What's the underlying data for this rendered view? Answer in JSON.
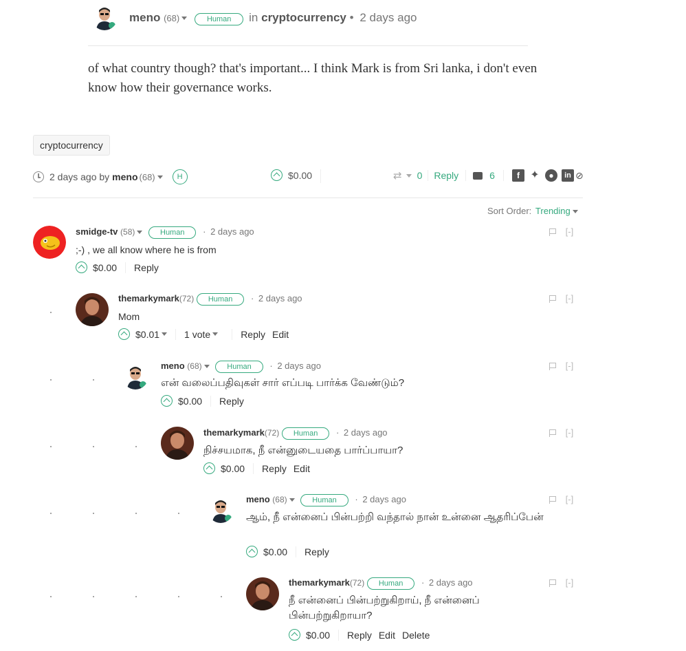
{
  "post": {
    "author": "meno",
    "reputation": "(68)",
    "badge": "Human",
    "in_word": "in",
    "community": "cryptocurrency",
    "bullet": "•",
    "time": "2 days ago",
    "body": "of what country though? that's important... I think Mark is from Sri lanka, i don't even know how their governance works.",
    "tag": "cryptocurrency",
    "footer": {
      "time": "2 days ago by",
      "author": "meno",
      "reputation": "(68)",
      "badge_short": "H",
      "payout": "$0.00",
      "reblogs": "0",
      "reply_label": "Reply",
      "comment_count": "6"
    }
  },
  "sort": {
    "label": "Sort Order:",
    "value": "Trending"
  },
  "comments": [
    {
      "author": "smidge-tv",
      "reputation": "(58)",
      "badge": "Human",
      "time": "2 days ago",
      "body": ";-) , we all know where he is from",
      "payout": "$0.00",
      "reply": "Reply",
      "collapse": "[-]"
    },
    {
      "author": "themarkymark",
      "reputation": "(72)",
      "badge": "Human",
      "time": "2 days ago",
      "body": "Mom",
      "payout": "$0.01",
      "votes": "1 vote",
      "reply": "Reply",
      "edit": "Edit",
      "collapse": "[-]"
    },
    {
      "author": "meno",
      "reputation": "(68)",
      "badge": "Human",
      "time": "2 days ago",
      "body": "என் வலைப்பதிவுகள் சார் எப்படி பார்க்க வேண்டும்?",
      "payout": "$0.00",
      "reply": "Reply",
      "collapse": "[-]"
    },
    {
      "author": "themarkymark",
      "reputation": "(72)",
      "badge": "Human",
      "time": "2 days ago",
      "body": "நிச்சயமாக, நீ என்னுடையதை பார்ப்பாயா?",
      "payout": "$0.00",
      "reply": "Reply",
      "edit": "Edit",
      "collapse": "[-]"
    },
    {
      "author": "meno",
      "reputation": "(68)",
      "badge": "Human",
      "time": "2 days ago",
      "body": "ஆம், நீ என்னைப் பின்பற்றி வந்தால் நான் உன்னை ஆதரிப்பேன்",
      "payout": "$0.00",
      "reply": "Reply",
      "collapse": "[-]"
    },
    {
      "author": "themarkymark",
      "reputation": "(72)",
      "badge": "Human",
      "time": "2 days ago",
      "body": "நீ என்னைப் பின்பற்றுகிறாய், நீ என்னைப் பின்பற்றுகிறாயா?",
      "payout": "$0.00",
      "reply": "Reply",
      "edit": "Edit",
      "delete": "Delete",
      "collapse": "[-]"
    }
  ],
  "colors": {
    "accent": "#35a97e",
    "text": "#333333",
    "muted": "#777777"
  }
}
